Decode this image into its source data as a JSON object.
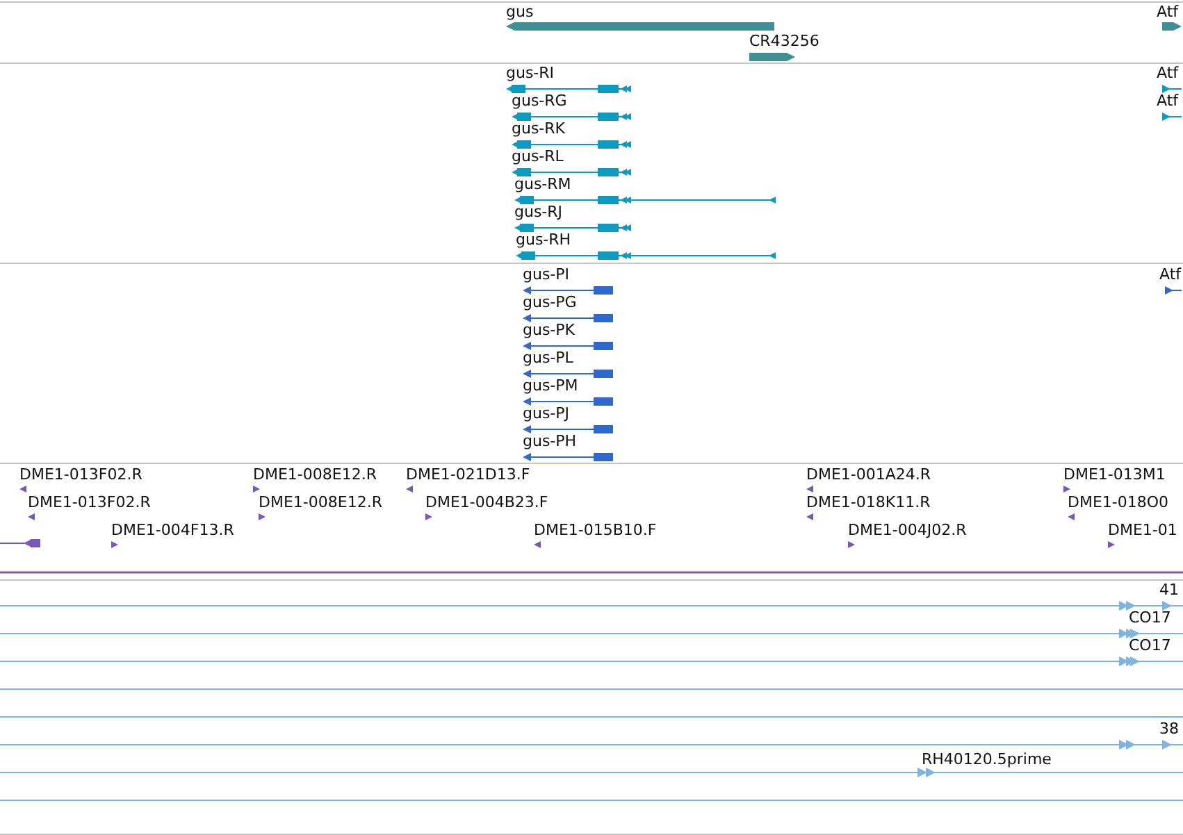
{
  "tracks": [
    {
      "kind": "gene",
      "features": [
        {
          "label": "gus",
          "reverse": true
        },
        {
          "label": "CR43256",
          "reverse": false
        },
        {
          "label": "Atf",
          "reverse": false
        }
      ]
    },
    {
      "kind": "transcript",
      "features": [
        {
          "label": "gus-RI",
          "reverse": true
        },
        {
          "label": "gus-RG",
          "reverse": true
        },
        {
          "label": "gus-RK",
          "reverse": true
        },
        {
          "label": "gus-RL",
          "reverse": true
        },
        {
          "label": "gus-RM",
          "reverse": true
        },
        {
          "label": "gus-RJ",
          "reverse": true
        },
        {
          "label": "gus-RH",
          "reverse": true
        },
        {
          "label": "Atf",
          "reverse": false
        },
        {
          "label": "Atf",
          "reverse": false
        }
      ]
    },
    {
      "kind": "protein",
      "features": [
        {
          "label": "gus-PI",
          "reverse": true
        },
        {
          "label": "gus-PG",
          "reverse": true
        },
        {
          "label": "gus-PK",
          "reverse": true
        },
        {
          "label": "gus-PL",
          "reverse": true
        },
        {
          "label": "gus-PM",
          "reverse": true
        },
        {
          "label": "gus-PJ",
          "reverse": true
        },
        {
          "label": "gus-PH",
          "reverse": true
        },
        {
          "label": "Atf",
          "reverse": false
        }
      ]
    },
    {
      "kind": "marker",
      "features": [
        {
          "label": "DME1-013F02.R",
          "reverse": true
        },
        {
          "label": "DME1-008E12.R",
          "reverse": false
        },
        {
          "label": "DME1-021D13.F",
          "reverse": true
        },
        {
          "label": "DME1-001A24.R",
          "reverse": true
        },
        {
          "label": "DME1-013M1",
          "reverse": false
        },
        {
          "label": "DME1-013F02.R",
          "reverse": true
        },
        {
          "label": "DME1-008E12.R",
          "reverse": false
        },
        {
          "label": "DME1-004B23.F",
          "reverse": false
        },
        {
          "label": "DME1-018K11.R",
          "reverse": true
        },
        {
          "label": "DME1-018O0",
          "reverse": true
        },
        {
          "reverse": true
        },
        {
          "label": "DME1-004F13.R",
          "reverse": false
        },
        {
          "label": "DME1-015B10.F",
          "reverse": true
        },
        {
          "label": "DME1-004J02.R",
          "reverse": false
        },
        {
          "label": "DME1-01",
          "reverse": false
        }
      ]
    },
    {
      "kind": "alignment",
      "features": [
        {
          "label": "41",
          "reverse": false
        },
        {
          "label": "CO17",
          "reverse": false
        },
        {
          "label": "CO17",
          "reverse": false
        },
        {
          "label": "38",
          "reverse": false
        },
        {
          "label": "RH40120.5prime",
          "reverse": false
        }
      ]
    }
  ]
}
